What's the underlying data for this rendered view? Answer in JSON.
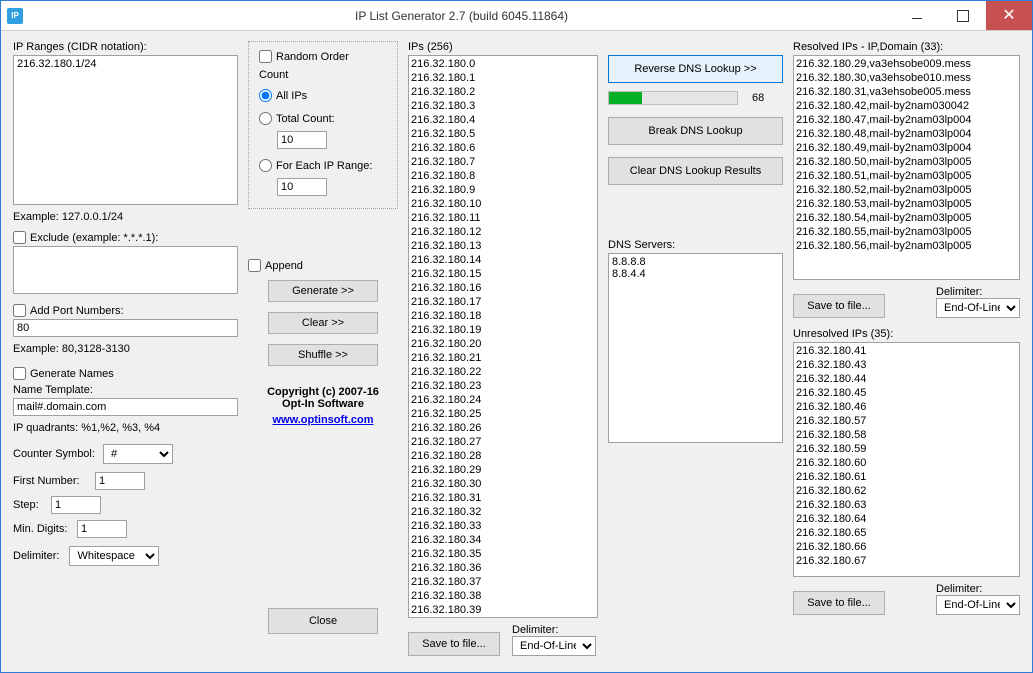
{
  "window": {
    "icon_text": "IP",
    "title": "IP List Generator 2.7 (build 6045.11864)"
  },
  "col1": {
    "ip_ranges_label": "IP Ranges (CIDR notation):",
    "ip_ranges_value": "216.32.180.1/24",
    "example_range": "Example: 127.0.0.1/24",
    "exclude_label": "Exclude (example: *.*.*.1):",
    "exclude_value": "",
    "add_port_label": "Add Port Numbers:",
    "port_value": "80",
    "example_ports": "Example: 80,3128-3130",
    "generate_names_label": "Generate Names",
    "name_template_label": "Name Template:",
    "name_template_value": "mail#.domain.com",
    "ip_quadrants": "IP quadrants: %1,%2, %3, %4",
    "counter_symbol_label": "Counter Symbol:",
    "counter_symbol_value": "#",
    "first_number_label": "First Number:",
    "first_number_value": "1",
    "step_label": "Step:",
    "step_value": "1",
    "min_digits_label": "Min. Digits:",
    "min_digits_value": "1",
    "delimiter_label": "Delimiter:",
    "delimiter_value": "Whitespace"
  },
  "col2": {
    "random_order_label": "Random Order",
    "count_legend": "Count",
    "all_ips_label": "All IPs",
    "total_count_label": "Total Count:",
    "total_count_value": "10",
    "for_each_label": "For Each IP Range:",
    "for_each_value": "10",
    "append_label": "Append",
    "generate_btn": "Generate >>",
    "clear_btn": "Clear >>",
    "shuffle_btn": "Shuffle >>",
    "copyright1": "Copyright (c) 2007-16",
    "copyright2": "Opt-In Software",
    "website": "www.optinsoft.com",
    "close_btn": "Close"
  },
  "col3": {
    "ips_label": "IPs (256)",
    "ips": [
      "216.32.180.0",
      "216.32.180.1",
      "216.32.180.2",
      "216.32.180.3",
      "216.32.180.4",
      "216.32.180.5",
      "216.32.180.6",
      "216.32.180.7",
      "216.32.180.8",
      "216.32.180.9",
      "216.32.180.10",
      "216.32.180.11",
      "216.32.180.12",
      "216.32.180.13",
      "216.32.180.14",
      "216.32.180.15",
      "216.32.180.16",
      "216.32.180.17",
      "216.32.180.18",
      "216.32.180.19",
      "216.32.180.20",
      "216.32.180.21",
      "216.32.180.22",
      "216.32.180.23",
      "216.32.180.24",
      "216.32.180.25",
      "216.32.180.26",
      "216.32.180.27",
      "216.32.180.28",
      "216.32.180.29",
      "216.32.180.30",
      "216.32.180.31",
      "216.32.180.32",
      "216.32.180.33",
      "216.32.180.34",
      "216.32.180.35",
      "216.32.180.36",
      "216.32.180.37",
      "216.32.180.38",
      "216.32.180.39"
    ],
    "save_btn": "Save to file...",
    "delimiter_label": "Delimiter:",
    "delimiter_value": "End-Of-Line"
  },
  "col4": {
    "reverse_dns_btn": "Reverse DNS Lookup >>",
    "progress_value": 26,
    "progress_text": "68",
    "break_dns_btn": "Break DNS Lookup",
    "clear_dns_btn": "Clear DNS Lookup Results",
    "dns_servers_label": "DNS Servers:",
    "dns_servers_value": "8.8.8.8\n8.8.4.4"
  },
  "col5": {
    "resolved_label": "Resolved IPs - IP,Domain (33):",
    "resolved": [
      "216.32.180.29,va3ehsobe009.mess",
      "216.32.180.30,va3ehsobe010.mess",
      "216.32.180.31,va3ehsobe005.mess",
      "216.32.180.42,mail-by2nam030042",
      "216.32.180.47,mail-by2nam03lp004",
      "216.32.180.48,mail-by2nam03lp004",
      "216.32.180.49,mail-by2nam03lp004",
      "216.32.180.50,mail-by2nam03lp005",
      "216.32.180.51,mail-by2nam03lp005",
      "216.32.180.52,mail-by2nam03lp005",
      "216.32.180.53,mail-by2nam03lp005",
      "216.32.180.54,mail-by2nam03lp005",
      "216.32.180.55,mail-by2nam03lp005",
      "216.32.180.56,mail-by2nam03lp005"
    ],
    "save_btn1": "Save to file...",
    "delimiter_label": "Delimiter:",
    "delimiter_value1": "End-Of-Line",
    "unresolved_label": "Unresolved IPs (35):",
    "unresolved": [
      "216.32.180.41",
      "216.32.180.43",
      "216.32.180.44",
      "216.32.180.45",
      "216.32.180.46",
      "216.32.180.57",
      "216.32.180.58",
      "216.32.180.59",
      "216.32.180.60",
      "216.32.180.61",
      "216.32.180.62",
      "216.32.180.63",
      "216.32.180.64",
      "216.32.180.65",
      "216.32.180.66",
      "216.32.180.67"
    ],
    "save_btn2": "Save to file...",
    "delimiter_value2": "End-Of-Line"
  }
}
